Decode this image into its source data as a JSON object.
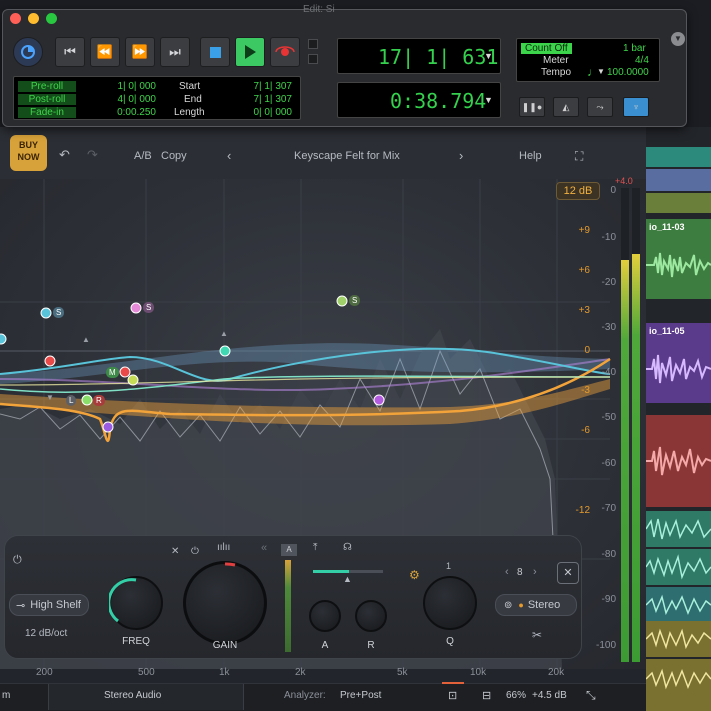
{
  "transport": {
    "title": "Edit: Si",
    "counter_main": "17| 1| 631",
    "counter_sub": "0:38.794",
    "preroll_label": "Pre-roll",
    "preroll_value": "1| 0| 000",
    "postroll_label": "Post-roll",
    "postroll_value": "4| 0| 000",
    "fadein_label": "Fade-in",
    "fadein_value": "0:00.250",
    "start_label": "Start",
    "start_value": "7| 1| 307",
    "end_label": "End",
    "end_value": "7| 1| 307",
    "length_label": "Length",
    "length_value": "0| 0| 000",
    "countoff_label": "Count Off",
    "countoff_value": "1 bar",
    "meter_label": "Meter",
    "meter_value": "4/4",
    "tempo_label": "Tempo",
    "tempo_value": "100.0000"
  },
  "plugin": {
    "buy_now": "BUY NOW",
    "ab": "A/B",
    "copy": "Copy",
    "preset": "Keyscape Felt for Mix",
    "help": "Help",
    "range_button": "12 dB",
    "gain_scale": [
      "+9",
      "+6",
      "+3",
      "0",
      "-3",
      "-6",
      "-12"
    ],
    "db_scale": [
      "0",
      "-10",
      "-20",
      "-30",
      "-40",
      "-50",
      "-60",
      "-70",
      "-80",
      "-90",
      "-100"
    ],
    "freq_scale": [
      "200",
      "500",
      "1k",
      "2k",
      "5k",
      "10k",
      "20k"
    ],
    "meter_peak": "+4.0",
    "node_tags": {
      "s1": "S",
      "s2": "S",
      "s3": "S",
      "m": "M",
      "l": "L",
      "r": "R"
    },
    "band": {
      "shape": "High Shelf",
      "slope": "12 dB/oct",
      "freq_label": "FREQ",
      "gain_label": "GAIN",
      "q_label": "Q",
      "a_label": "A",
      "r_label": "R",
      "auto_label": "A",
      "band_count": "8",
      "q_band": "1",
      "stereo": "Stereo"
    },
    "status": {
      "left": "m",
      "routing": "Stereo Audio",
      "analyzer_label": "Analyzer:",
      "analyzer_value": "Pre+Post",
      "zoom": "66%",
      "gain_scale": "+4.5 dB"
    }
  },
  "daw": {
    "clip1": "io_11-03",
    "clip2": "io_11-05"
  },
  "colors": {
    "accent_green": "#3fd44b",
    "eq_cyan": "#59c3d9",
    "eq_orange": "#f2a33a",
    "eq_purple": "#a05ce0"
  }
}
